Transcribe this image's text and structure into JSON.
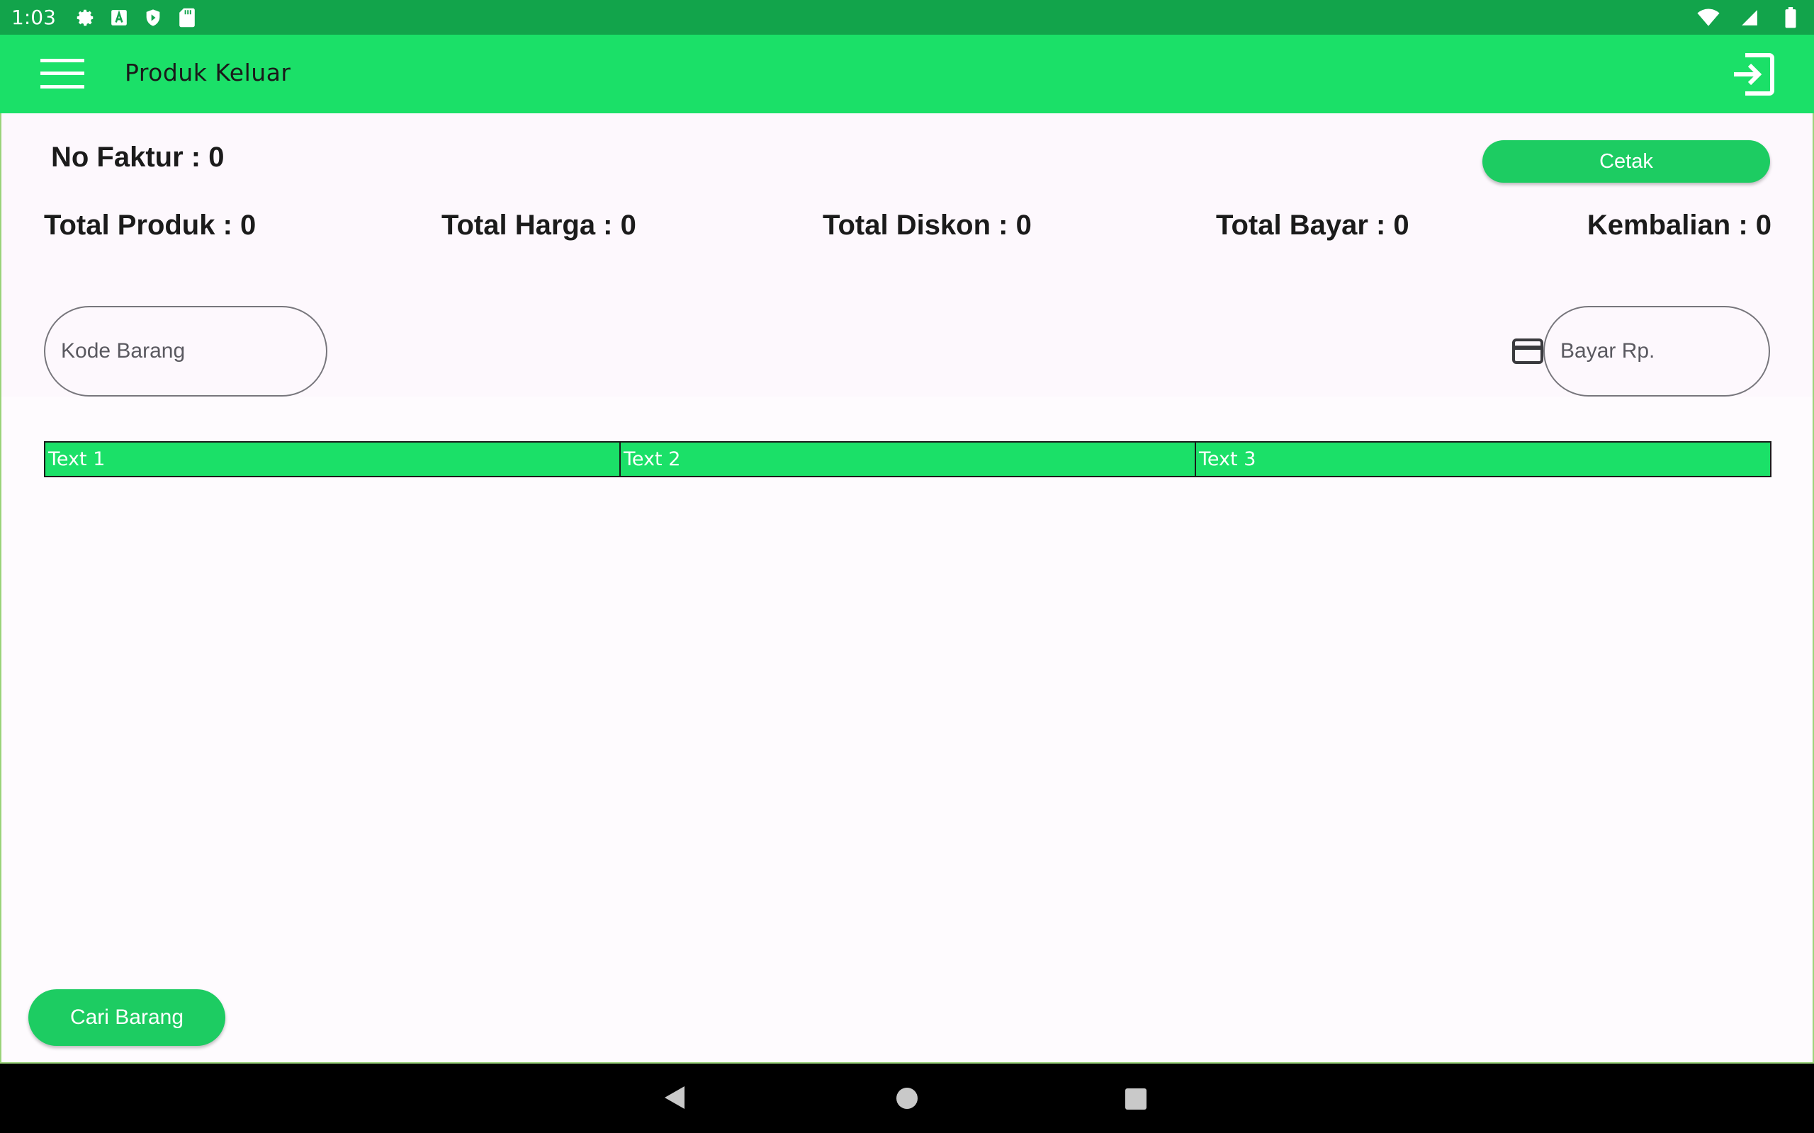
{
  "status_bar": {
    "time": "1:03",
    "icons": [
      "gear-icon",
      "a-icon",
      "shield-icon",
      "sd-card-icon",
      "wifi-icon",
      "signal-icon",
      "battery-icon"
    ]
  },
  "app_bar": {
    "title": "Produk Keluar",
    "menu_icon": "hamburger-menu-icon",
    "logout_icon": "exit-icon",
    "color": "#1be068"
  },
  "invoice": {
    "no_faktur_label": "No Faktur : 0",
    "print_button": "Cetak"
  },
  "totals": {
    "total_produk": "Total Produk : 0",
    "total_harga": "Total Harga : 0",
    "total_diskon": "Total Diskon : 0",
    "total_bayar": "Total Bayar : 0",
    "kembalian": "Kembalian : 0"
  },
  "inputs": {
    "kode_barang_placeholder": "Kode Barang",
    "bayar_placeholder": "Bayar Rp.",
    "payment_icon": "credit-card-icon"
  },
  "table": {
    "header": [
      "Text 1",
      "Text 2",
      "Text 3"
    ]
  },
  "actions": {
    "cari_barang": "Cari Barang"
  },
  "colors": {
    "accent": "#1be068",
    "button": "#1dcc62",
    "status_bar": "#12a44b"
  }
}
